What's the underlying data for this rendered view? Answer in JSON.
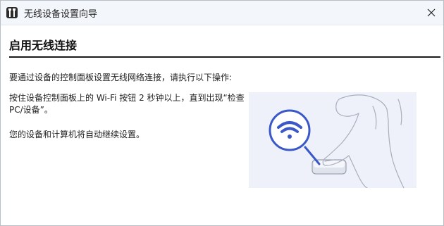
{
  "window": {
    "title": "无线设备设置向导"
  },
  "page": {
    "heading": "启用无线连接",
    "intro": "要通过设备的控制面板设置无线网络连接，请执行以下操作:",
    "step1": "按住设备控制面板上的 Wi-Fi 按钮 2 秒钟以上，直到出现“检查 PC/设备”。",
    "step2": "您的设备和计算机将自动继续设置。"
  },
  "colors": {
    "accent": "#3a58c8",
    "illustration_bg": "#eef1fa"
  },
  "icons": {
    "app": "tools-icon",
    "close": "close-icon",
    "wifi": "wifi-icon"
  }
}
